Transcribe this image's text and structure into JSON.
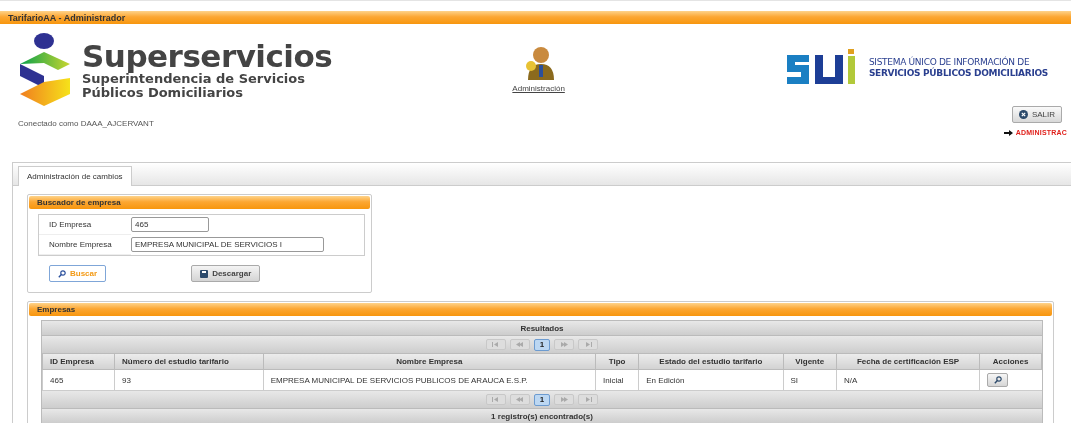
{
  "window": {
    "title": "TarifarioAA - Administrador"
  },
  "header": {
    "brand": "Superservicios",
    "brand_subtitle_1": "Superintendencia de Servicios",
    "brand_subtitle_2": "Públicos Domiciliarios",
    "admin_link": "Administración",
    "sui_line_1": "SISTEMA ÚNICO DE INFORMACIÓN DE",
    "sui_line_2": "SERVICIOS PÚBLICOS DOMICILIARIOS",
    "connected_as": "Conectado como DAAA_AJCERVANT",
    "logout_button": "SALIR",
    "breadcrumb": "ADMINISTRAC"
  },
  "tabs": [
    {
      "label": "Administración de cambios",
      "selected": true
    }
  ],
  "search_panel": {
    "title": "Buscador de empresa",
    "fields": [
      {
        "label": "ID Empresa",
        "value": "465"
      },
      {
        "label": "Nombre Empresa",
        "value": "EMPRESA MUNICIPAL DE SERVICIOS I"
      }
    ],
    "search_button": "Buscar",
    "download_button": "Descargar"
  },
  "results_panel": {
    "title": "Empresas",
    "table_caption": "Resultados",
    "top_pages": [
      {
        "label": "1",
        "selected": true
      }
    ],
    "bottom_pages": [
      {
        "label": "1",
        "selected": true
      }
    ],
    "columns": [
      "ID Empresa",
      "Número del estudio tarifario",
      "Nombre Empresa",
      "Tipo",
      "Estado del estudio tarifario",
      "Vigente",
      "Fecha de certificación ESP",
      "Acciones"
    ],
    "rows": [
      {
        "cells": [
          "465",
          "93",
          "EMPRESA MUNICIPAL DE SERVICIOS PUBLICOS DE ARAUCA E.S.P.",
          "Inicial",
          "En Edición",
          "SI",
          "N/A"
        ]
      }
    ],
    "footer": "1 registro(s) encontrado(s)"
  }
}
